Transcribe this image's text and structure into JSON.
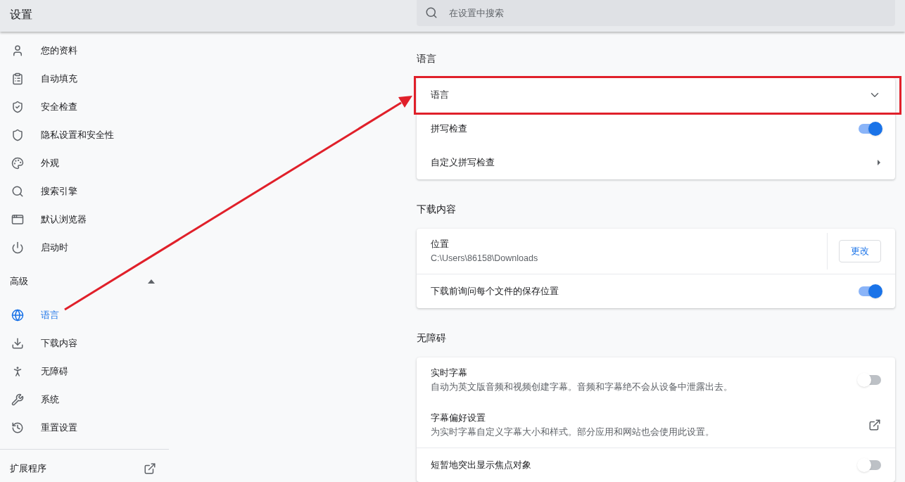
{
  "header": {
    "title": "设置",
    "search": {
      "placeholder": "在设置中搜索"
    }
  },
  "sidebar": {
    "items": [
      {
        "label": "您的资料",
        "selected": false
      },
      {
        "label": "自动填充",
        "selected": false
      },
      {
        "label": "安全检查",
        "selected": false
      },
      {
        "label": "隐私设置和安全性",
        "selected": false
      },
      {
        "label": "外观",
        "selected": false
      },
      {
        "label": "搜索引擎",
        "selected": false
      },
      {
        "label": "默认浏览器",
        "selected": false
      },
      {
        "label": "启动时",
        "selected": false
      }
    ],
    "advanced": {
      "label": "高级",
      "expanded": true,
      "items": [
        {
          "label": "语言",
          "selected": true
        },
        {
          "label": "下载内容",
          "selected": false
        },
        {
          "label": "无障碍",
          "selected": false
        },
        {
          "label": "系统",
          "selected": false
        },
        {
          "label": "重置设置",
          "selected": false
        }
      ]
    },
    "extensions": {
      "label": "扩展程序"
    }
  },
  "sections": [
    {
      "title": "语言",
      "rows": [
        {
          "kind": "expand",
          "label": "语言",
          "expanded": false,
          "separated": false
        },
        {
          "kind": "toggle",
          "label": "拼写检查",
          "on": true,
          "separated": false
        },
        {
          "kind": "submenu",
          "label": "自定义拼写检查",
          "separated": false
        }
      ]
    },
    {
      "title": "下载内容",
      "rows": [
        {
          "kind": "location",
          "label": "位置",
          "sublabel": "C:\\Users\\86158\\Downloads",
          "button": "更改",
          "separated": false
        },
        {
          "kind": "toggle",
          "label": "下载前询问每个文件的保存位置",
          "on": true,
          "separated": true
        }
      ]
    },
    {
      "title": "无障碍",
      "rows": [
        {
          "kind": "toggle",
          "label": "实时字幕",
          "sublabel": "自动为英文版音频和视频创建字幕。音频和字幕绝不会从设备中泄露出去。",
          "on": false,
          "separated": false
        },
        {
          "kind": "external",
          "label": "字幕偏好设置",
          "sublabel": "为实时字幕自定义字幕大小和样式。部分应用和网站也会使用此设置。",
          "separated": false
        },
        {
          "kind": "toggle",
          "label": "短暂地突出显示焦点对象",
          "on": false,
          "separated": true
        }
      ]
    }
  ],
  "annotation": {
    "highlight": true,
    "arrow": true
  }
}
